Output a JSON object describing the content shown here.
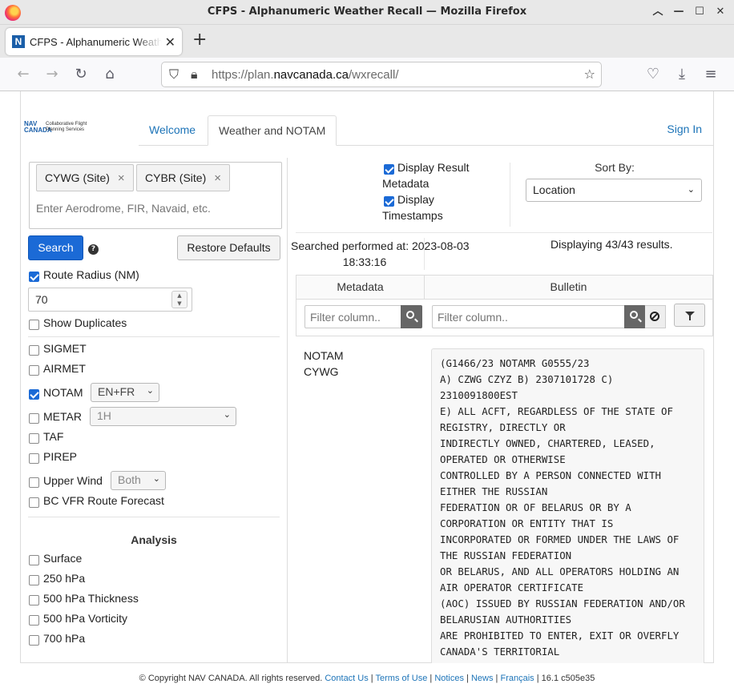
{
  "window": {
    "title": "CFPS - Alphanumeric Weather Recall — Mozilla Firefox"
  },
  "browser": {
    "tab_title": "CFPS - Alphanumeric Weather Recall",
    "tab_favicon": "N",
    "url_prefix": "https://plan.",
    "url_domain": "navcanada.ca",
    "url_suffix": "/wxrecall/"
  },
  "header": {
    "logo_text": "NAV CANADA",
    "logo_sub": "Collaborative Flight Planning Services",
    "tabs": [
      {
        "label": "Welcome"
      },
      {
        "label": "Weather and NOTAM"
      }
    ],
    "sign_in": "Sign In"
  },
  "search": {
    "chips": [
      {
        "label": "CYWG (Site)"
      },
      {
        "label": "CYBR (Site)"
      }
    ],
    "placeholder": "Enter Aerodrome, FIR, Navaid, etc.",
    "search_label": "Search",
    "restore_label": "Restore Defaults",
    "route_radius_label": "Route Radius (NM)",
    "route_radius_value": "70",
    "show_duplicates_label": "Show Duplicates"
  },
  "products": [
    {
      "label": "SIGMET",
      "checked": false
    },
    {
      "label": "AIRMET",
      "checked": false
    },
    {
      "label": "NOTAM",
      "checked": true,
      "select": "EN+FR"
    },
    {
      "label": "METAR",
      "checked": false,
      "select": "1H"
    },
    {
      "label": "TAF",
      "checked": false
    },
    {
      "label": "PIREP",
      "checked": false
    },
    {
      "label": "Upper Wind",
      "checked": false,
      "select": "Both"
    },
    {
      "label": "BC VFR Route Forecast",
      "checked": false
    }
  ],
  "analysis": {
    "title": "Analysis",
    "items": [
      {
        "label": "Surface"
      },
      {
        "label": "250 hPa"
      },
      {
        "label": "500 hPa Thickness"
      },
      {
        "label": "500 hPa Vorticity"
      },
      {
        "label": "700 hPa"
      }
    ]
  },
  "options": {
    "display_metadata_1": "Display Result",
    "display_metadata_2": "Metadata",
    "display_timestamps_1": "Display",
    "display_timestamps_2": "Timestamps",
    "sort_by_label": "Sort By:",
    "sort_by_value": "Location"
  },
  "results": {
    "performed_1": "Searched performed at: 2023-08-03",
    "performed_2": "18:33:16",
    "displaying": "Displaying 43/43 results.",
    "col_metadata": "Metadata",
    "col_bulletin": "Bulletin",
    "filter_placeholder": "Filter column..",
    "row_type": "NOTAM",
    "row_site": "CYWG",
    "bulletin_text": "(G1466/23 NOTAMR G0555/23\nA) CZWG CZYZ B) 2307101728 C)\n2310091800EST\nE) ALL ACFT, REGARDLESS OF THE STATE OF\nREGISTRY, DIRECTLY OR\nINDIRECTLY OWNED, CHARTERED, LEASED,\nOPERATED OR OTHERWISE\nCONTROLLED BY A PERSON CONNECTED WITH\nEITHER THE RUSSIAN\nFEDERATION OR OF BELARUS OR BY A\nCORPORATION OR ENTITY THAT IS\nINCORPORATED OR FORMED UNDER THE LAWS OF\nTHE RUSSIAN FEDERATION\nOR BELARUS, AND ALL OPERATORS HOLDING AN\nAIR OPERATOR CERTIFICATE\n(AOC) ISSUED BY RUSSIAN FEDERATION AND/OR\nBELARUSIAN AUTHORITIES\nARE PROHIBITED TO ENTER, EXIT OR OVERFLY\nCANADA'S TERRITORIAL"
  },
  "footer": {
    "copyright": "© Copyright NAV CANADA. All rights reserved.",
    "links": [
      "Contact Us",
      "Terms of Use",
      "Notices",
      "News",
      "Français"
    ],
    "version": "16.1 c505e35"
  },
  "colors": {
    "primary": "#1b6ad6",
    "link": "#1d74b8"
  }
}
